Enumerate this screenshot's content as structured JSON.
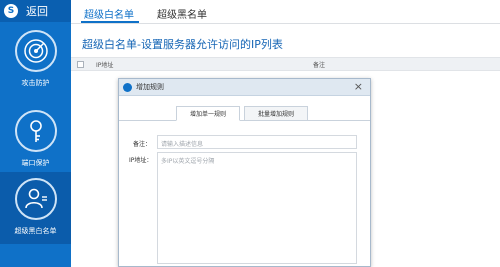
{
  "sidebar": {
    "back_label": "返回",
    "logo_glyph": "S",
    "items": [
      {
        "label": "攻击防护",
        "icon": "radar-icon",
        "active": false
      },
      {
        "label": "端口保护",
        "icon": "key-icon",
        "active": false
      },
      {
        "label": "超级黑白名单",
        "icon": "user-list-icon",
        "active": true
      }
    ]
  },
  "tabs": [
    {
      "label": "超级白名单",
      "active": true
    },
    {
      "label": "超级黑名单",
      "active": false
    }
  ],
  "page_title": "超级白名单-设置服务器允许访问的IP列表",
  "table": {
    "columns": [
      "IP地址",
      "备注"
    ]
  },
  "dialog": {
    "title": "增加规则",
    "close_glyph": "×",
    "tabs": [
      {
        "label": "增加单一规则",
        "active": true
      },
      {
        "label": "批量增加规则",
        "active": false
      }
    ],
    "note_label": "备注：",
    "note_placeholder": "请输入描述信息",
    "ip_label": "IP地址：",
    "ip_placeholder": "多IP以英文逗号分隔"
  },
  "colors": {
    "brand": "#0f71c8",
    "sidebar_active": "#0b5cab",
    "title_text": "#1565b5"
  }
}
